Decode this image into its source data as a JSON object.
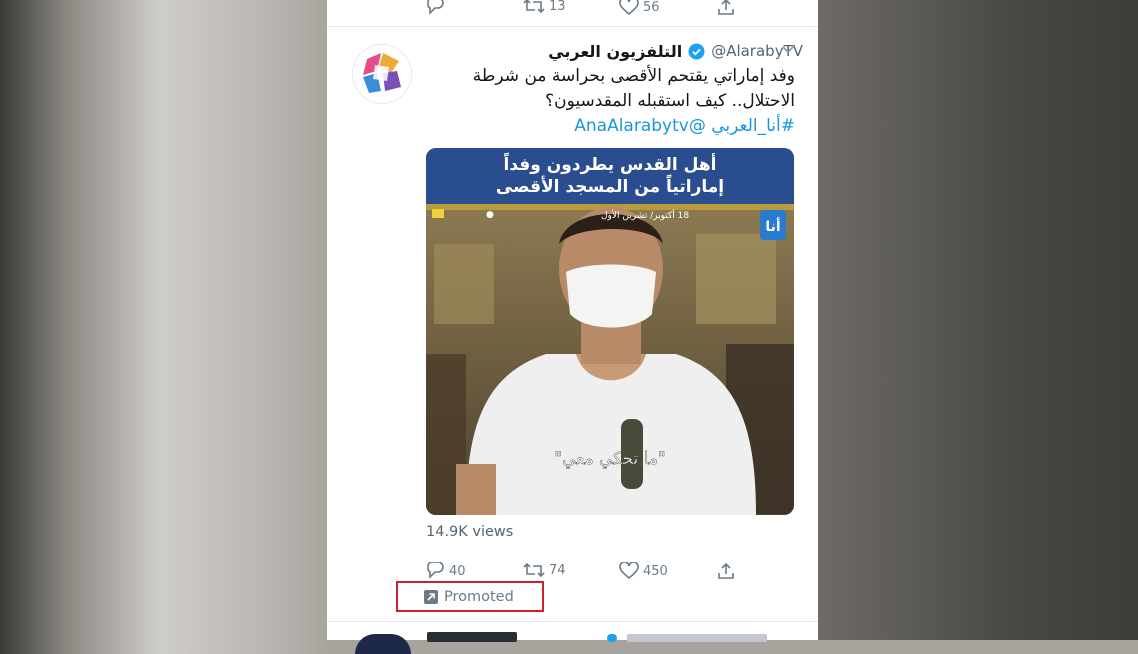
{
  "top_actions": {
    "retweets": "13",
    "likes": "56"
  },
  "tweet": {
    "display_name": "التلفزيون العربي",
    "handle": "@AlarabyTV",
    "text_line1": "وفد إماراتي يقتحم الأقصى بحراسة من شرطة",
    "text_line2": "الاحتلال.. كيف استقبله المقدسيون؟",
    "hashtag": "#أنا_العربي",
    "mention": "@AnaAlarabytv",
    "video": {
      "banner_line1": "أهل القدس يطردون وفداً",
      "banner_line2": "إماراتياً من المسجد الأقصى",
      "date_overlay": "18 أكتوبر/ تشرين الأول",
      "channel_logo": "أنا",
      "subtitle": "\"ما تحكي معي\""
    },
    "views": "14.9K views",
    "replies": "40",
    "retweets": "74",
    "likes": "450",
    "promoted_label": "Promoted"
  },
  "colors": {
    "link": "#1b95e0",
    "verified": "#1da1f2",
    "highlight_box": "#c8222b",
    "banner": "#2a4d8f"
  },
  "icons": [
    "reply-icon",
    "retweet-icon",
    "like-icon",
    "share-icon",
    "verified-badge-icon",
    "chevron-down-icon",
    "promoted-arrow-icon"
  ]
}
